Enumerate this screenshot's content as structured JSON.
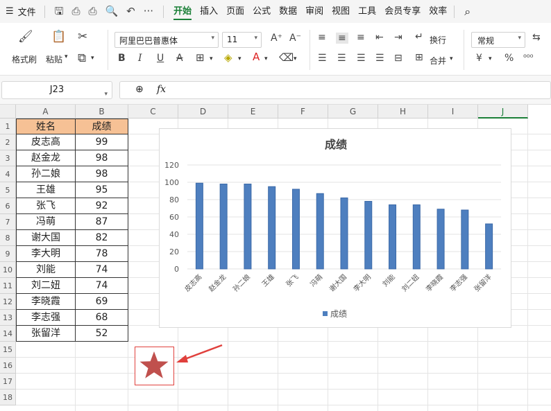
{
  "menubar": {
    "file_label": "文件",
    "more_label": "···",
    "tabs": [
      "开始",
      "插入",
      "页面",
      "公式",
      "数据",
      "审阅",
      "视图",
      "工具",
      "会员专享",
      "效率"
    ],
    "active_tab": "开始"
  },
  "ribbon": {
    "format_painter": "格式刷",
    "paste": "粘贴",
    "font_name": "阿里巴巴普惠体",
    "font_size": "11",
    "wrap_text": "换行",
    "merge": "合并",
    "number_format": "常规",
    "percent": "%",
    "currency": "¥"
  },
  "formula_bar": {
    "cell_ref": "J23",
    "fx": "fx",
    "formula": ""
  },
  "grid": {
    "columns": [
      "A",
      "B",
      "C",
      "D",
      "E",
      "F",
      "G",
      "H",
      "I",
      "J"
    ],
    "selected_column": "J",
    "rows": [
      "1",
      "2",
      "3",
      "4",
      "5",
      "6",
      "7",
      "8",
      "9",
      "10",
      "11",
      "12",
      "13",
      "14",
      "15",
      "16",
      "17",
      "18"
    ]
  },
  "table": {
    "headers": [
      "姓名",
      "成绩"
    ],
    "rows": [
      [
        "皮志高",
        "99"
      ],
      [
        "赵金龙",
        "98"
      ],
      [
        "孙二娘",
        "98"
      ],
      [
        "王雄",
        "95"
      ],
      [
        "张飞",
        "92"
      ],
      [
        "冯萌",
        "87"
      ],
      [
        "谢大国",
        "82"
      ],
      [
        "李大明",
        "78"
      ],
      [
        "刘能",
        "74"
      ],
      [
        "刘二妞",
        "74"
      ],
      [
        "李晓霞",
        "69"
      ],
      [
        "李志强",
        "68"
      ],
      [
        "张留洋",
        "52"
      ]
    ]
  },
  "chart_data": {
    "type": "bar",
    "title": "成绩",
    "categories": [
      "皮志高",
      "赵金龙",
      "孙二娘",
      "王雄",
      "张飞",
      "冯萌",
      "谢大国",
      "李大明",
      "刘能",
      "刘二妞",
      "李晓霞",
      "李志强",
      "张留洋"
    ],
    "series": [
      {
        "name": "成绩",
        "values": [
          99,
          98,
          98,
          95,
          92,
          87,
          82,
          78,
          74,
          74,
          69,
          68,
          52
        ]
      }
    ],
    "ylim": [
      0,
      120
    ],
    "yticks": [
      0,
      20,
      40,
      60,
      80,
      100,
      120
    ],
    "grid": true,
    "legend": "bottom",
    "color": "#4e7fbf"
  },
  "colors": {
    "accent": "#1a7f37",
    "header_fill": "#f6c195",
    "bar": "#4e7fbf",
    "star": "#c0504d",
    "annotation": "#e0403c"
  }
}
